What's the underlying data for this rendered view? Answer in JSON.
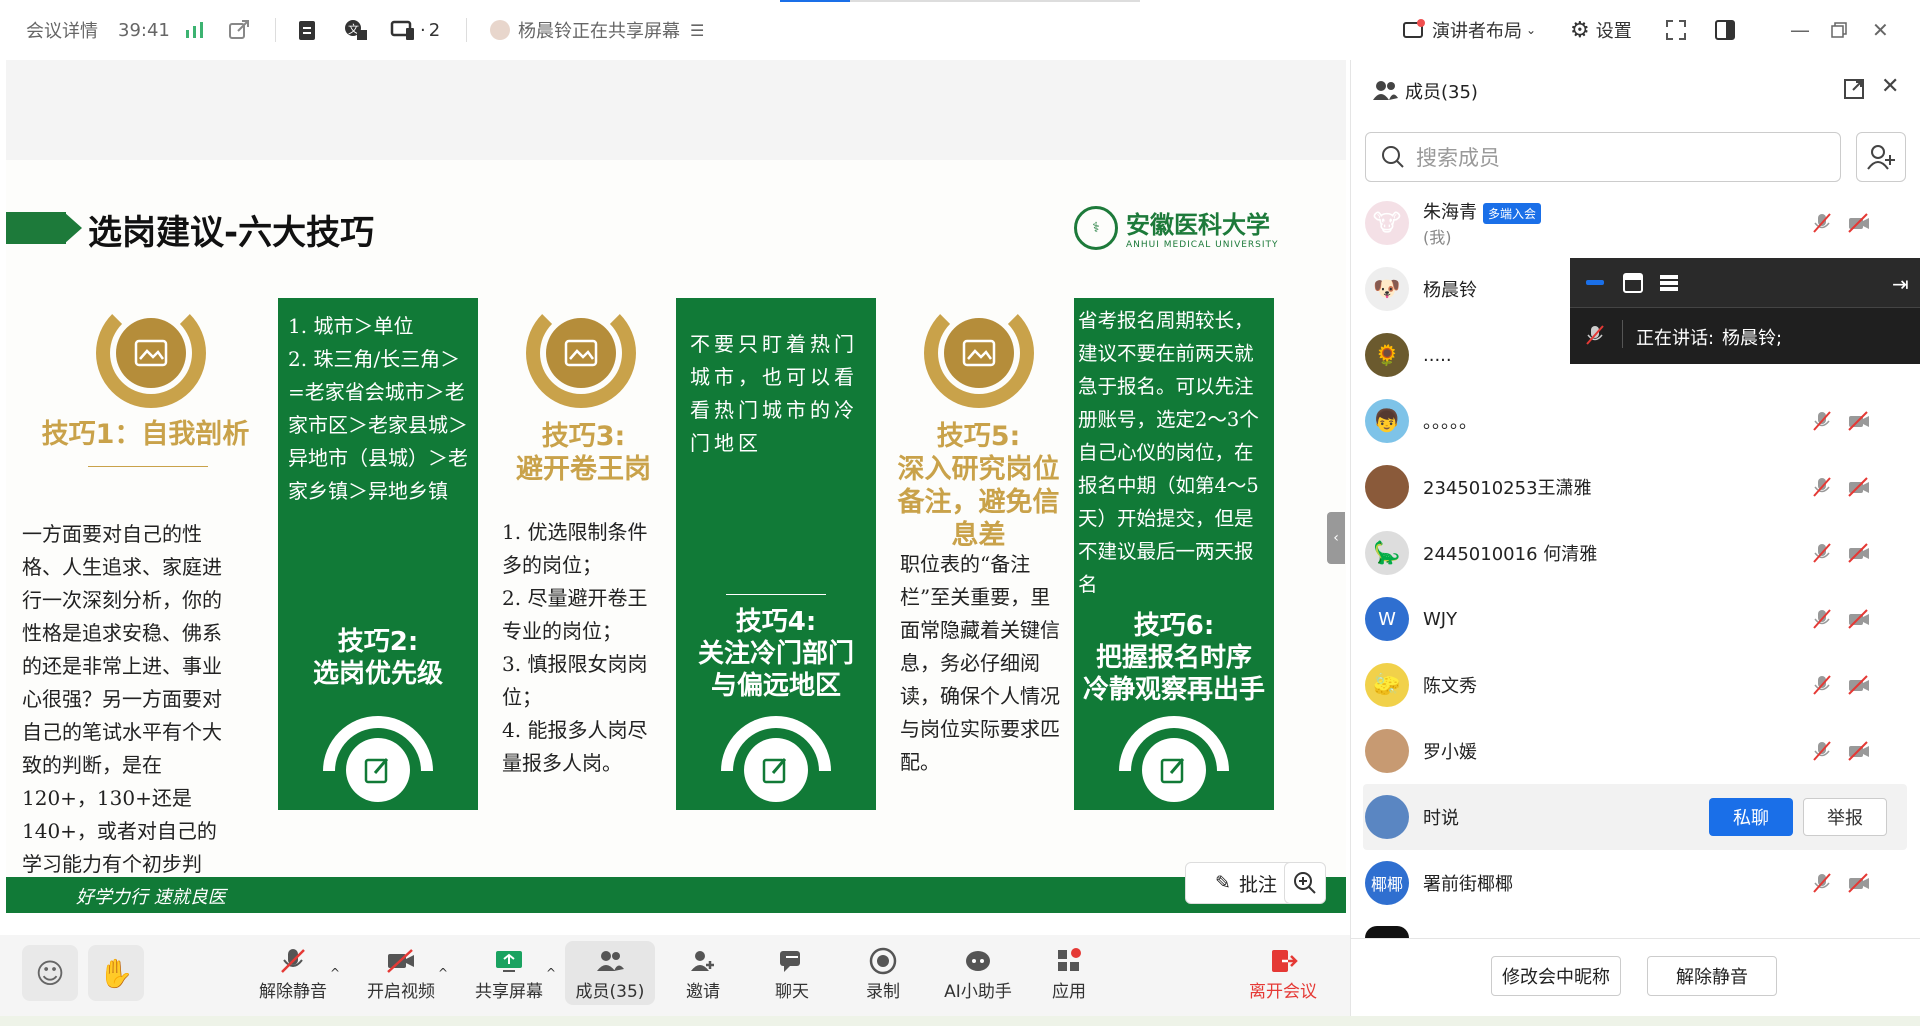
{
  "topbar": {
    "meeting_details": "会议详情",
    "timer": "39:41",
    "participants_count": "2",
    "sharing_status": "杨晨铃正在共享屏幕",
    "layout_label": "演讲者布局",
    "settings_label": "设置"
  },
  "slide": {
    "title": "选岗建议-六大技巧",
    "logo_cn": "安徽医科大学",
    "logo_en": "ANHUI MEDICAL UNIVERSITY",
    "tip1_title": "技巧1：自我剖析",
    "tip1_body": "一方面要对自己的性格、人生追求、家庭进行一次深刻分析，你的性格是追求安稳、佛系的还是非常上进、事业心很强？另一方面要对自己的笔试水平有个大致的判断，是在120+，130+还是140+，或者对自己的学习能力有个初步判断。",
    "tip2_body": "1. 城市＞单位\n2. 珠三角/长三角＞=老家省会城市＞老家市区＞老家县城＞异地市（县城）＞老家乡镇＞异地乡镇",
    "tip2_title": "技巧2:\n选岗优先级",
    "tip3_title": "技巧3:\n避开卷王岗",
    "tip3_body": "1. 优选限制条件多的岗位；\n2. 尽量避开卷王专业的岗位；\n3. 慎报限女岗岗位；\n4. 能报多人岗尽量报多人岗。",
    "tip4_body": "不要只盯着热门城市，也可以看看热门城市的冷门地区",
    "tip4_title": "技巧4:\n关注冷门部门\n与偏远地区",
    "tip5_title": "技巧5:\n深入研究岗位\n备注，避免信\n息差",
    "tip5_body": "职位表的“备注栏”至关重要，里面常隐藏着关键信息，务必仔细阅读，确保个人情况与岗位实际要求匹配。",
    "tip6_body": "省考报名周期较长，建议不要在前两天就急于报名。可以先注册账号，选定2～3个自己心仪的岗位，在报名中期（如第4～5天）开始提交，但是不建议最后一两天报名",
    "tip6_title": "技巧6:\n把握报名时序\n冷静观察再出手",
    "footer_motto": "好学力行  速就良医"
  },
  "stage": {
    "annotate_label": "批注"
  },
  "bottombar": {
    "unmute": "解除静音",
    "video": "开启视频",
    "share": "共享屏幕",
    "members": "成员(35)",
    "invite": "邀请",
    "chat": "聊天",
    "record": "录制",
    "ai": "AI小助手",
    "apps": "应用",
    "leave": "离开会议"
  },
  "panel": {
    "title": "成员(35)",
    "search_placeholder": "搜索成员",
    "members": [
      {
        "name": "朱海青",
        "badge": "多端入会",
        "sub": "(我)"
      },
      {
        "name": "杨晨铃"
      },
      {
        "name": "....."
      },
      {
        "name": "。。。。。"
      },
      {
        "name": "2345010253王潇雅"
      },
      {
        "name": "2445010016 何清雅"
      },
      {
        "name": "WJY",
        "initial": "W"
      },
      {
        "name": "陈文秀"
      },
      {
        "name": "罗小媛"
      },
      {
        "name": "时说"
      },
      {
        "name": "署前街椰椰",
        "initial": "椰椰"
      }
    ],
    "private_chat": "私聊",
    "report": "举报",
    "speaking_label": "正在讲话:",
    "speaking_name": "杨晨铃;",
    "rename_button": "修改会中昵称",
    "unmute_button": "解除静音"
  }
}
